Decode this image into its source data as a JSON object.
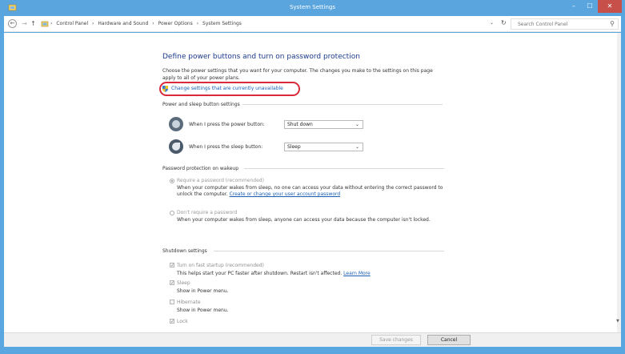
{
  "window": {
    "title": "System Settings",
    "minimize_glyph": "–",
    "maximize_glyph": "☐",
    "close_glyph": "✕"
  },
  "address_bar": {
    "back_glyph": "←",
    "forward_glyph": "→",
    "up_glyph": "↑",
    "crumbs": [
      "Control Panel",
      "Hardware and Sound",
      "Power Options",
      "System Settings"
    ],
    "separator": "›",
    "dropdown_glyph": "⌄",
    "refresh_glyph": "↻",
    "search_placeholder": "Search Control Panel",
    "search_glyph": "⚲"
  },
  "page": {
    "heading": "Define power buttons and turn on password protection",
    "description": "Choose the power settings that you want for your computer. The changes you make to the settings on this page apply to all of your power plans.",
    "change_link": "Change settings that are currently unavailable"
  },
  "power_sleep": {
    "label": "Power and sleep button settings",
    "rows": [
      {
        "label": "When I press the power button:",
        "value": "Shut down"
      },
      {
        "label": "When I press the sleep button:",
        "value": "Sleep"
      }
    ],
    "chevron": "⌄"
  },
  "password": {
    "label": "Password protection on wakeup",
    "options": [
      {
        "title": "Require a password (recommended)",
        "desc": "When your computer wakes from sleep, no one can access your data without entering the correct password to unlock the computer.",
        "link": "Create or change your user account password",
        "checked": true
      },
      {
        "title": "Don't require a password",
        "desc": "When your computer wakes from sleep, anyone can access your data because the computer isn't locked.",
        "link": "",
        "checked": false
      }
    ]
  },
  "shutdown": {
    "label": "Shutdown settings",
    "items": [
      {
        "title": "Turn on fast startup (recommended)",
        "desc": "This helps start your PC faster after shutdown. Restart isn't affected.",
        "link": "Learn More",
        "checked": true
      },
      {
        "title": "Sleep",
        "desc": "Show in Power menu.",
        "link": "",
        "checked": true
      },
      {
        "title": "Hibernate",
        "desc": "Show in Power menu.",
        "link": "",
        "checked": false
      },
      {
        "title": "Lock",
        "desc": "",
        "link": "",
        "checked": true
      }
    ],
    "check_glyph": "✓"
  },
  "footer": {
    "save_label": "Save changes",
    "cancel_label": "Cancel"
  },
  "colors": {
    "titlebar": "#5ba5df",
    "close": "#c7504b",
    "heading": "#1c3b8c",
    "link": "#1a5fb4",
    "highlight_ring": "#d92b3a"
  }
}
